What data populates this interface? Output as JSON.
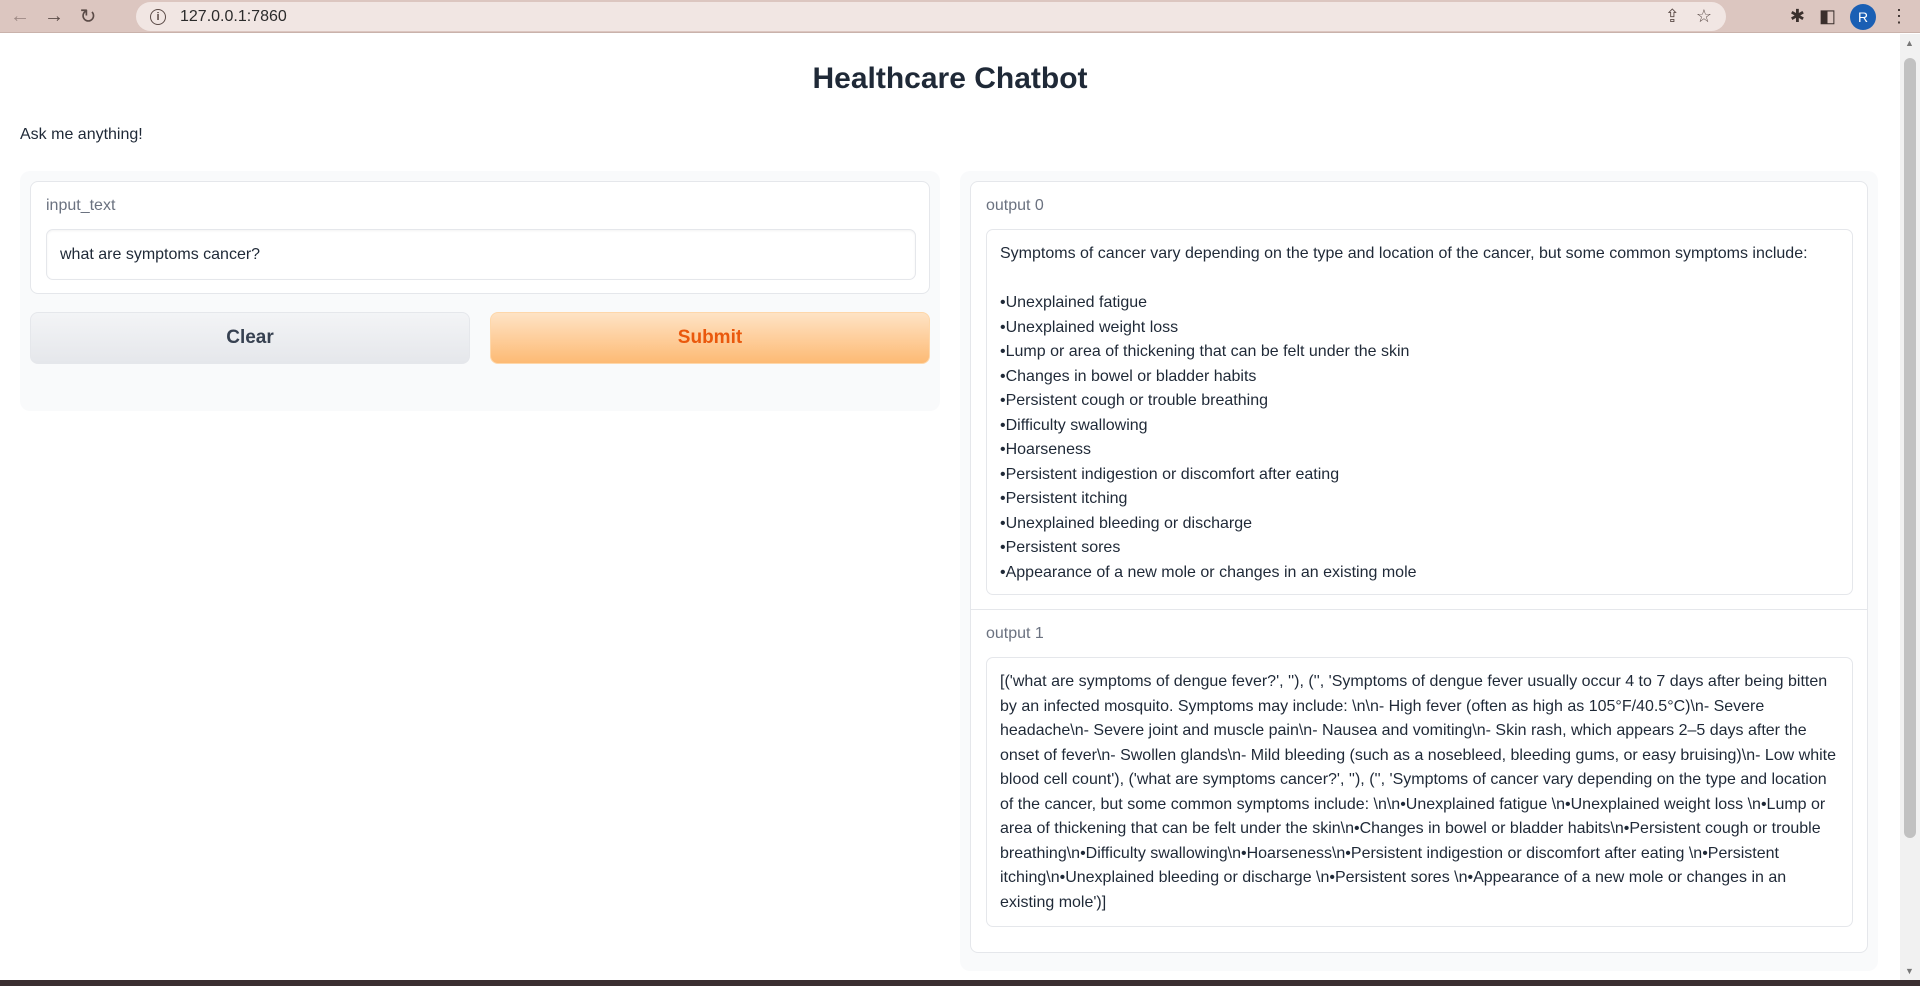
{
  "browser": {
    "url": "127.0.0.1:7860",
    "profile_initial": "R"
  },
  "page": {
    "title": "Healthcare Chatbot",
    "description": "Ask me anything!"
  },
  "input": {
    "label": "input_text",
    "value": "what are symptoms cancer?"
  },
  "buttons": {
    "clear": "Clear",
    "submit": "Submit"
  },
  "outputs": [
    {
      "label": "output 0",
      "text": "Symptoms of cancer vary depending on the type and location of the cancer, but some common symptoms include:\n\n•Unexplained fatigue\n•Unexplained weight loss\n•Lump or area of thickening that can be felt under the skin\n•Changes in bowel or bladder habits\n•Persistent cough or trouble breathing\n•Difficulty swallowing\n•Hoarseness\n•Persistent indigestion or discomfort after eating\n•Persistent itching\n•Unexplained bleeding or discharge\n•Persistent sores\n•Appearance of a new mole or changes in an existing mole"
    },
    {
      "label": "output 1",
      "text": "[('what are symptoms of dengue fever?', ''), ('', 'Symptoms of dengue fever usually occur 4 to 7 days after being bitten by an infected mosquito. Symptoms may include: \\n\\n- High fever (often as high as 105°F/40.5°C)\\n- Severe headache\\n- Severe joint and muscle pain\\n- Nausea and vomiting\\n- Skin rash, which appears 2–5 days after the onset of fever\\n- Swollen glands\\n- Mild bleeding (such as a nosebleed, bleeding gums, or easy bruising)\\n- Low white blood cell count'), ('what are symptoms cancer?', ''), ('', 'Symptoms of cancer vary depending on the type and location of the cancer, but some common symptoms include: \\n\\n•Unexplained fatigue \\n•Unexplained weight loss \\n•Lump or area of thickening that can be felt under the skin\\n•Changes in bowel or bladder habits\\n•Persistent cough or trouble breathing\\n•Difficulty swallowing\\n•Hoarseness\\n•Persistent indigestion or discomfort after eating \\n•Persistent itching\\n•Unexplained bleeding or discharge \\n•Persistent sores \\n•Appearance of a new mole or changes in an existing mole')]"
    }
  ]
}
